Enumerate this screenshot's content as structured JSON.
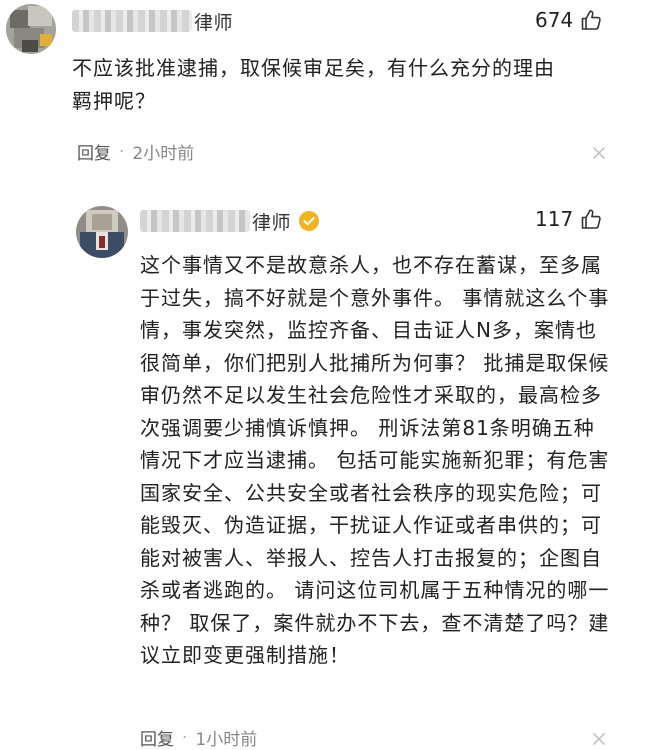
{
  "comments": [
    {
      "author_suffix": "律师",
      "likes": "674",
      "content": "不应该批准逮捕，取保候审足矣，有什么充分的理由羁押呢？",
      "reply_label": "回复",
      "separator": "·",
      "time": "2小时前",
      "verified": false,
      "icons": [
        "avatar",
        "thumb-up-icon",
        "close-icon"
      ]
    },
    {
      "author_suffix": "律师",
      "likes": "117",
      "content": "这个事情又不是故意杀人，也不存在蓄谋，至多属于过失，搞不好就是个意外事件。 事情就这么个事情，事发突然，监控齐备、目击证人N多，案情也很简单，你们把别人批捕所为何事？ 批捕是取保候审仍然不足以发生社会危险性才采取的，最高检多次强调要少捕慎诉慎押。 刑诉法第81条明确五种情况下才应当逮捕。 包括可能实施新犯罪；有危害国家安全、公共安全或者社会秩序的现实危险；可能毁灭、伪造证据，干扰证人作证或者串供的；可能对被害人、举报人、控告人打击报复的；企图自杀或者逃跑的。 请问这位司机属于五种情况的哪一种？ 取保了，案件就办不下去，查不清楚了吗？建议立即变更强制措施！",
      "reply_label": "回复",
      "separator": "·",
      "time": "1小时前",
      "verified": true,
      "icons": [
        "avatar",
        "verified-icon",
        "thumb-up-icon",
        "close-icon"
      ]
    }
  ],
  "colors": {
    "text": "#222222",
    "meta": "#888888",
    "verified": "#f0b323"
  }
}
